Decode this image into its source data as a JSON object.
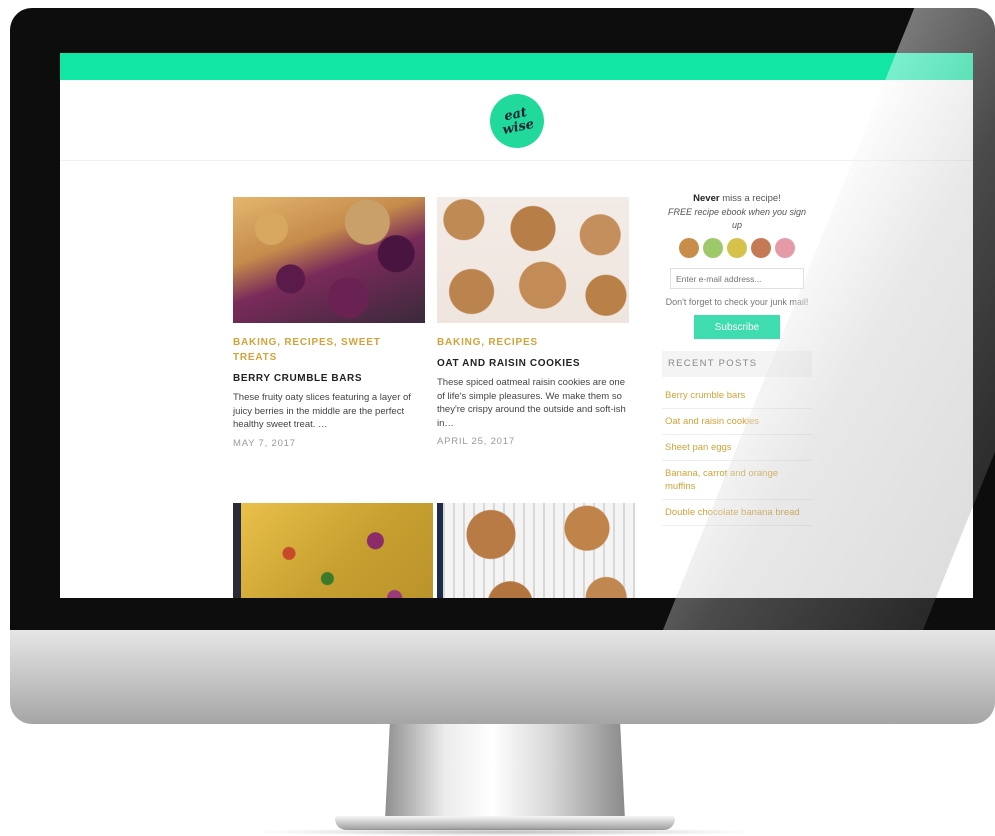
{
  "logo": {
    "line1": "eat",
    "line2": "wise"
  },
  "posts": [
    {
      "categories": "BAKING, RECIPES, SWEET TREATS",
      "title": "BERRY CRUMBLE BARS",
      "excerpt": "These fruity oaty slices featuring a layer of juicy berries in the middle are the perfect healthy sweet treat. …",
      "date": "MAY 7, 2017"
    },
    {
      "categories": "BAKING, RECIPES",
      "title": "OAT AND RAISIN COOKIES",
      "excerpt": "These spiced oatmeal raisin cookies are one of life's simple pleasures. We make them so they're crispy around the outside and soft-ish in…",
      "date": "APRIL 25, 2017"
    }
  ],
  "sidebar": {
    "headline_bold": "Never",
    "headline_rest": " miss a recipe!",
    "subtext": "FREE recipe ebook when you sign up",
    "email_placeholder": "Enter e-mail address...",
    "note": "Don't forget to check your junk mail!",
    "subscribe_label": "Subscribe",
    "recent_heading": "RECENT POSTS",
    "recent_posts": [
      "Berry crumble bars",
      "Oat and raisin cookies",
      "Sheet pan eggs",
      "Banana, carrot and orange muffins",
      "Double chocolate banana bread"
    ]
  },
  "colors": {
    "accent": "#12e6a5",
    "category": "#d1a33a",
    "subscribe": "#3fdcb0"
  }
}
